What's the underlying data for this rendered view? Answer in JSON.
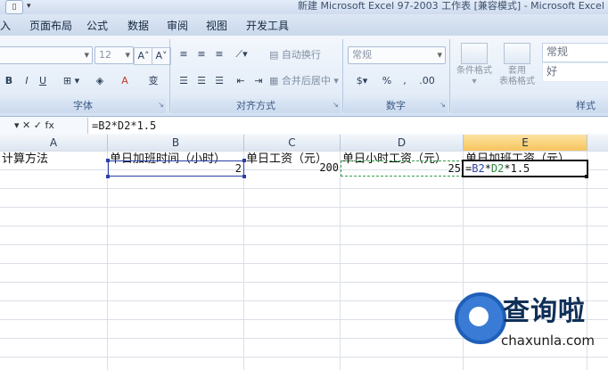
{
  "window": {
    "title": "新建 Microsoft Excel 97-2003 工作表 [兼容模式] - Microsoft Excel"
  },
  "qat": {
    "icon": "document-icon",
    "dropdown": "▾"
  },
  "tabs": [
    {
      "label": "入"
    },
    {
      "label": "页面布局"
    },
    {
      "label": "公式"
    },
    {
      "label": "数据"
    },
    {
      "label": "审阅"
    },
    {
      "label": "视图"
    },
    {
      "label": "开发工具"
    }
  ],
  "ribbon": {
    "font": {
      "font_size": "12",
      "grow_label": "A˄",
      "shrink_label": "A˅",
      "bold": "B",
      "italic": "I",
      "underline": "U",
      "font_color": "A",
      "phonetic": "变",
      "group_label": "字体"
    },
    "alignment": {
      "wrap_text": "自动换行",
      "merge_center": "合并后居中",
      "group_label": "对齐方式"
    },
    "number": {
      "format_value": "常规",
      "percent": "%",
      "comma": ",",
      "inc_decimal": ".00",
      "group_label": "数字"
    },
    "styles": {
      "conditional_format": "条件格式",
      "table_format_line1": "套用",
      "table_format_line2": "表格格式",
      "style_normal": "常规",
      "style_good": "好",
      "group_label": "样式"
    }
  },
  "formula_bar": {
    "controls": "▾ ✕ ✓ fx",
    "formula": "=B2*D2*1.5"
  },
  "sheet": {
    "columns": [
      "A",
      "B",
      "C",
      "D",
      "E"
    ],
    "active_column": "E",
    "row1": {
      "A": "计算方法",
      "B": "单日加班时间（小时）",
      "C": "单日工资（元）",
      "D": "单日小时工资（元）",
      "E": "单日加班工资（元）"
    },
    "row2": {
      "B": "2",
      "C": "200",
      "D": "25",
      "E_prefix": "=",
      "E_ref1": "B2",
      "E_op1": "*",
      "E_ref2": "D2",
      "E_suffix": "*1.5"
    }
  },
  "watermark": {
    "brand": "查询啦",
    "url": "chaxunla.com"
  },
  "colors": {
    "ribbon_bg": "#e4edf8",
    "active_header": "#f6c45d",
    "ref_b_color": "#2a3fa8",
    "ref_d_color": "#2a8a3e"
  }
}
